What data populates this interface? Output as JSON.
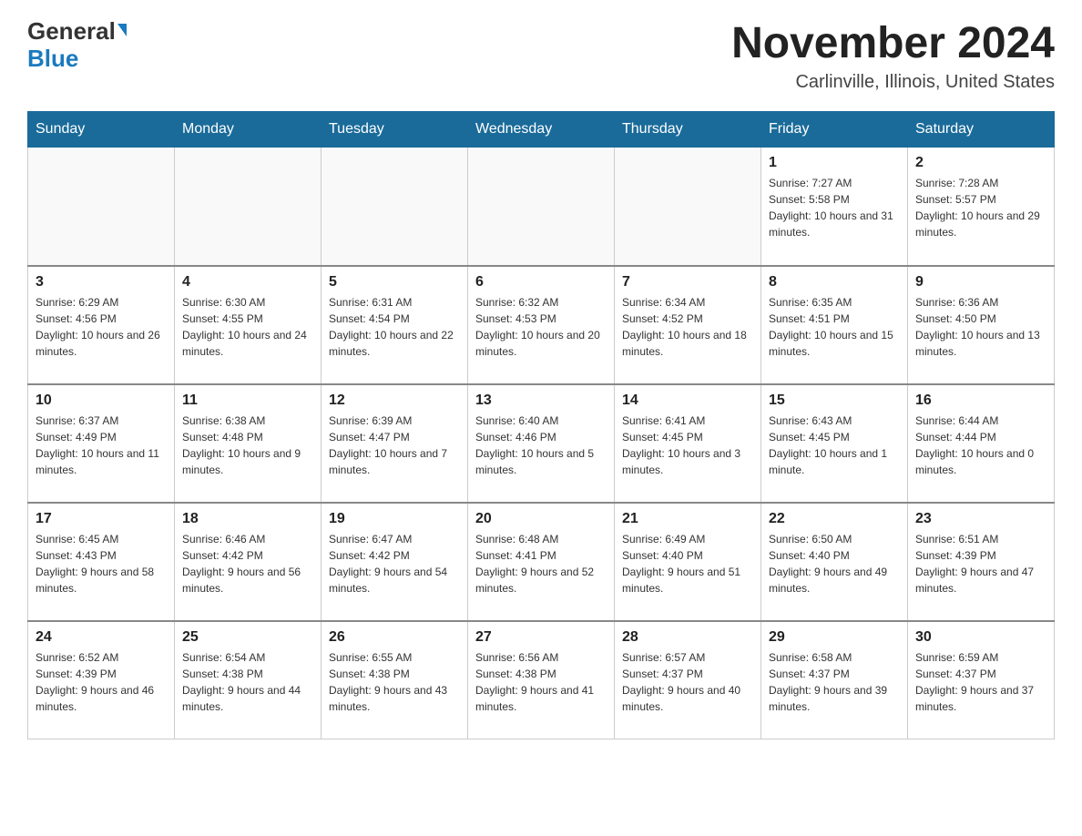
{
  "header": {
    "logo_general": "General",
    "logo_blue": "Blue",
    "month_title": "November 2024",
    "location": "Carlinville, Illinois, United States"
  },
  "weekdays": [
    "Sunday",
    "Monday",
    "Tuesday",
    "Wednesday",
    "Thursday",
    "Friday",
    "Saturday"
  ],
  "weeks": [
    [
      {
        "day": "",
        "info": ""
      },
      {
        "day": "",
        "info": ""
      },
      {
        "day": "",
        "info": ""
      },
      {
        "day": "",
        "info": ""
      },
      {
        "day": "",
        "info": ""
      },
      {
        "day": "1",
        "info": "Sunrise: 7:27 AM\nSunset: 5:58 PM\nDaylight: 10 hours and 31 minutes."
      },
      {
        "day": "2",
        "info": "Sunrise: 7:28 AM\nSunset: 5:57 PM\nDaylight: 10 hours and 29 minutes."
      }
    ],
    [
      {
        "day": "3",
        "info": "Sunrise: 6:29 AM\nSunset: 4:56 PM\nDaylight: 10 hours and 26 minutes."
      },
      {
        "day": "4",
        "info": "Sunrise: 6:30 AM\nSunset: 4:55 PM\nDaylight: 10 hours and 24 minutes."
      },
      {
        "day": "5",
        "info": "Sunrise: 6:31 AM\nSunset: 4:54 PM\nDaylight: 10 hours and 22 minutes."
      },
      {
        "day": "6",
        "info": "Sunrise: 6:32 AM\nSunset: 4:53 PM\nDaylight: 10 hours and 20 minutes."
      },
      {
        "day": "7",
        "info": "Sunrise: 6:34 AM\nSunset: 4:52 PM\nDaylight: 10 hours and 18 minutes."
      },
      {
        "day": "8",
        "info": "Sunrise: 6:35 AM\nSunset: 4:51 PM\nDaylight: 10 hours and 15 minutes."
      },
      {
        "day": "9",
        "info": "Sunrise: 6:36 AM\nSunset: 4:50 PM\nDaylight: 10 hours and 13 minutes."
      }
    ],
    [
      {
        "day": "10",
        "info": "Sunrise: 6:37 AM\nSunset: 4:49 PM\nDaylight: 10 hours and 11 minutes."
      },
      {
        "day": "11",
        "info": "Sunrise: 6:38 AM\nSunset: 4:48 PM\nDaylight: 10 hours and 9 minutes."
      },
      {
        "day": "12",
        "info": "Sunrise: 6:39 AM\nSunset: 4:47 PM\nDaylight: 10 hours and 7 minutes."
      },
      {
        "day": "13",
        "info": "Sunrise: 6:40 AM\nSunset: 4:46 PM\nDaylight: 10 hours and 5 minutes."
      },
      {
        "day": "14",
        "info": "Sunrise: 6:41 AM\nSunset: 4:45 PM\nDaylight: 10 hours and 3 minutes."
      },
      {
        "day": "15",
        "info": "Sunrise: 6:43 AM\nSunset: 4:45 PM\nDaylight: 10 hours and 1 minute."
      },
      {
        "day": "16",
        "info": "Sunrise: 6:44 AM\nSunset: 4:44 PM\nDaylight: 10 hours and 0 minutes."
      }
    ],
    [
      {
        "day": "17",
        "info": "Sunrise: 6:45 AM\nSunset: 4:43 PM\nDaylight: 9 hours and 58 minutes."
      },
      {
        "day": "18",
        "info": "Sunrise: 6:46 AM\nSunset: 4:42 PM\nDaylight: 9 hours and 56 minutes."
      },
      {
        "day": "19",
        "info": "Sunrise: 6:47 AM\nSunset: 4:42 PM\nDaylight: 9 hours and 54 minutes."
      },
      {
        "day": "20",
        "info": "Sunrise: 6:48 AM\nSunset: 4:41 PM\nDaylight: 9 hours and 52 minutes."
      },
      {
        "day": "21",
        "info": "Sunrise: 6:49 AM\nSunset: 4:40 PM\nDaylight: 9 hours and 51 minutes."
      },
      {
        "day": "22",
        "info": "Sunrise: 6:50 AM\nSunset: 4:40 PM\nDaylight: 9 hours and 49 minutes."
      },
      {
        "day": "23",
        "info": "Sunrise: 6:51 AM\nSunset: 4:39 PM\nDaylight: 9 hours and 47 minutes."
      }
    ],
    [
      {
        "day": "24",
        "info": "Sunrise: 6:52 AM\nSunset: 4:39 PM\nDaylight: 9 hours and 46 minutes."
      },
      {
        "day": "25",
        "info": "Sunrise: 6:54 AM\nSunset: 4:38 PM\nDaylight: 9 hours and 44 minutes."
      },
      {
        "day": "26",
        "info": "Sunrise: 6:55 AM\nSunset: 4:38 PM\nDaylight: 9 hours and 43 minutes."
      },
      {
        "day": "27",
        "info": "Sunrise: 6:56 AM\nSunset: 4:38 PM\nDaylight: 9 hours and 41 minutes."
      },
      {
        "day": "28",
        "info": "Sunrise: 6:57 AM\nSunset: 4:37 PM\nDaylight: 9 hours and 40 minutes."
      },
      {
        "day": "29",
        "info": "Sunrise: 6:58 AM\nSunset: 4:37 PM\nDaylight: 9 hours and 39 minutes."
      },
      {
        "day": "30",
        "info": "Sunrise: 6:59 AM\nSunset: 4:37 PM\nDaylight: 9 hours and 37 minutes."
      }
    ]
  ]
}
